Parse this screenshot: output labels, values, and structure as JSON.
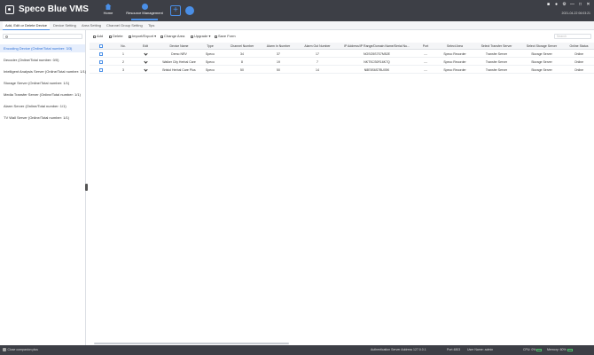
{
  "header": {
    "app_title": "Speco Blue VMS",
    "nav_home": "Home",
    "nav_resource": "Resource Management",
    "add_tab": "+",
    "clock": "2021-04-22 06:03:21",
    "window_icons": [
      "lock-icon",
      "user-icon",
      "settings-icon",
      "minimize-icon",
      "maximize-icon",
      "close-icon"
    ]
  },
  "subtabs": [
    "Add, Edit or Delete Device",
    "Device Setting",
    "Area Setting",
    "Channel Group Setting",
    "Tips"
  ],
  "left": {
    "categories": [
      "Encoding Device (Online/Total number: 3/3)",
      "Decoder (Online/Total number: 0/0)",
      "Intelligent Analysis Server (Online/Total number: 1/1)",
      "Storage Server (Online/Total number: 1/1)",
      "Media Transfer Server (Online/Total number: 1/1)",
      "Alarm Server (Online/Total number: 1/1)",
      "TV Wall Server (Online/Total number: 1/1)"
    ]
  },
  "toolbar": {
    "add": "Add",
    "delete": "Delete",
    "import_export": "Import/Export",
    "change_area": "Change Area",
    "upgrade": "Upgrade",
    "save_form": "Save Form",
    "search_placeholder": "Search"
  },
  "table": {
    "columns": [
      "No.",
      "Edit",
      "Device Name",
      "Type",
      "Channel Number",
      "Alarm In Number",
      "Alarm Out Number",
      "IP Address/IP Range/Domain Name/Serial Nu...",
      "Port",
      "Select Area",
      "Select Transfer Server",
      "Select Storage Server",
      "Online Status"
    ],
    "rows": [
      {
        "no": "1",
        "name": "Demo NRV",
        "type": "Speco",
        "channels": "34",
        "alarm_in": "37",
        "alarm_out": "17",
        "address": "NOSO5S7S7M52E",
        "port": "---",
        "area": "Speco Recorder",
        "transfer": "Transfer Server",
        "storage": "Storage Server",
        "status": "Online"
      },
      {
        "no": "2",
        "name": "Walker City Herbal Care",
        "type": "Speco",
        "channels": "8",
        "alarm_in": "19",
        "alarm_out": "7",
        "address": "NKTSCS0R16K7Q",
        "port": "---",
        "area": "Speco Recorder",
        "transfer": "Transfer Server",
        "storage": "Storage Server",
        "status": "Online"
      },
      {
        "no": "3",
        "name": "Bristol Herbal Care Plus",
        "type": "Speco",
        "channels": "50",
        "alarm_in": "50",
        "alarm_out": "14",
        "address": "N8E5S6S7BU05K",
        "port": "---",
        "area": "Speco Recorder",
        "transfer": "Transfer Server",
        "storage": "Storage Server",
        "status": "Online"
      }
    ]
  },
  "status": {
    "left": "Close companion plus",
    "auth": "Authentication Server Address 127.0.0.1",
    "port": "Port 4803",
    "user": "User Name: admin",
    "cpu": "CPU:",
    "cpu_val": "0%",
    "memory": "Memory:",
    "memory_val": "60%"
  },
  "colors": {
    "accent": "#4a8fe7",
    "header_bg": "#3d3f46",
    "selected_bg": "#e6eefc"
  }
}
